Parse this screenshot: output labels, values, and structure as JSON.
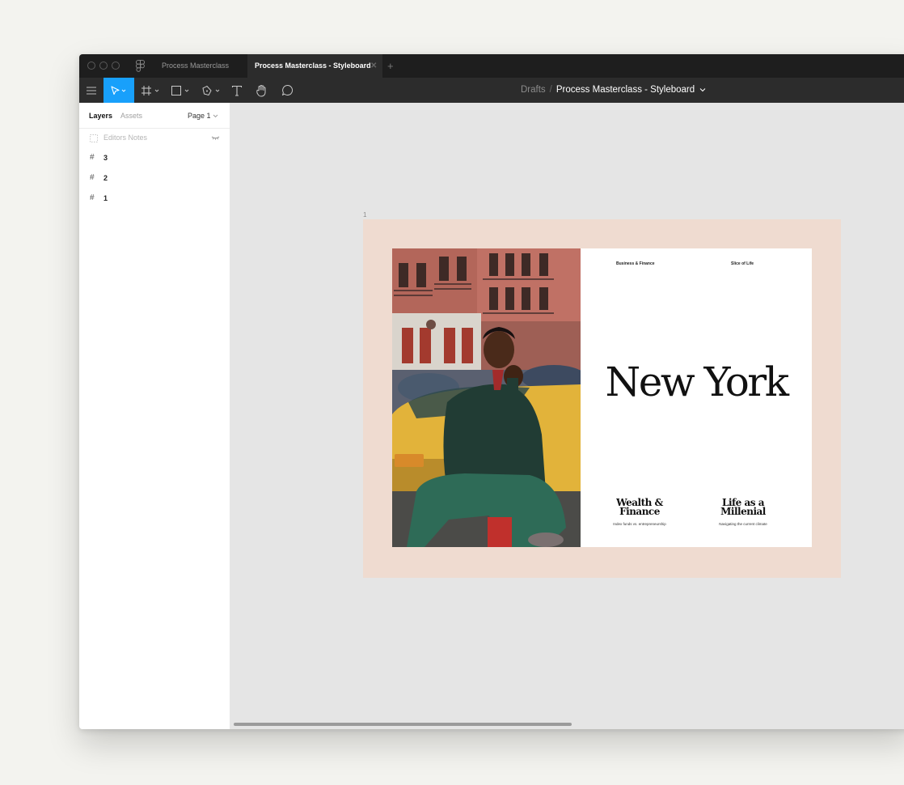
{
  "window": {
    "tabs": [
      {
        "label": "Process Masterclass",
        "active": false
      },
      {
        "label": "Process Masterclass - Styleboard",
        "active": true
      }
    ]
  },
  "toolbar": {
    "tools": [
      "menu-icon",
      "move-tool-icon",
      "frame-tool-icon",
      "shape-tool-icon",
      "pen-tool-icon",
      "text-tool-icon",
      "hand-tool-icon",
      "comment-tool-icon"
    ],
    "breadcrumb": {
      "parent": "Drafts",
      "separator": "/",
      "current": "Process Masterclass - Styleboard"
    },
    "accent_color": "#18a0fb"
  },
  "left_panel": {
    "tabs": [
      {
        "label": "Layers",
        "active": true
      },
      {
        "label": "Assets",
        "active": false
      }
    ],
    "page_selector": "Page 1",
    "layers": [
      {
        "name": "Editors Notes",
        "hidden": true
      },
      {
        "name": "3",
        "hidden": false
      },
      {
        "name": "2",
        "hidden": false
      },
      {
        "name": "1",
        "hidden": false
      }
    ]
  },
  "canvas": {
    "frame_label": "1",
    "frame_color": "#efdbd0",
    "magazine": {
      "section_left": "Business & Finance",
      "section_right": "Slice of Life",
      "headline": "New York",
      "stories": [
        {
          "title_line1": "Wealth &",
          "title_line2": "Finance",
          "subtitle": "Index funds vs. entrepreneurship"
        },
        {
          "title_line1": "Life as a",
          "title_line2": "Millenial",
          "subtitle": "Navigating the current climate"
        }
      ]
    }
  }
}
